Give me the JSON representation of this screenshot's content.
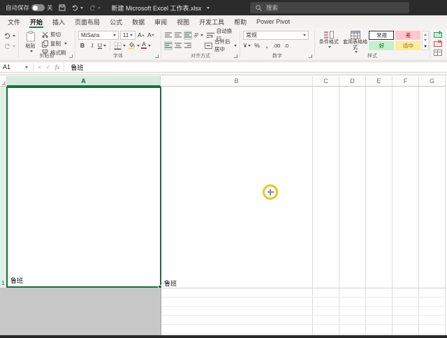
{
  "titlebar": {
    "autosave_label": "自动保存",
    "autosave_state": "关",
    "doc_title": "新建 Microsoft Excel 工作表.xlsx",
    "search_placeholder": "搜索"
  },
  "tabs": [
    "文件",
    "开始",
    "插入",
    "页面布局",
    "公式",
    "数据",
    "审阅",
    "视图",
    "开发工具",
    "帮助",
    "Power Pivot"
  ],
  "ribbon": {
    "clipboard": {
      "group_label": "剪贴板",
      "paste_label": "粘贴",
      "cut_label": "剪切",
      "copy_label": "复制",
      "format_painter_label": "格式刷"
    },
    "font": {
      "group_label": "字体",
      "font_name": "MiSans",
      "font_size": "11",
      "bold_glyph": "B",
      "italic_glyph": "I",
      "underline_glyph": "U",
      "grow_font_glyph": "A",
      "shrink_font_glyph": "A"
    },
    "alignment": {
      "group_label": "对齐方式",
      "wrap_text_label": "自动换行",
      "merge_center_label": "合并后居中"
    },
    "number": {
      "group_label": "数字",
      "format_value": "常规",
      "currency_glyph": "¥",
      "percent_glyph": "%",
      "comma_glyph": ",",
      "increase_decimal_glyph": ".00",
      "decrease_decimal_glyph": ".0"
    },
    "styles": {
      "group_label": "样式",
      "conditional_label": "条件格式",
      "format_table_label": "套用表格格式",
      "gallery": [
        {
          "label": "常规",
          "bg": "#ffffff",
          "fg": "#222222"
        },
        {
          "label": "差",
          "bg": "#ffc7ce",
          "fg": "#9c0006"
        },
        {
          "label": "好",
          "bg": "#c6efce",
          "fg": "#006100"
        },
        {
          "label": "适中",
          "bg": "#ffeb9c",
          "fg": "#9c6500"
        }
      ]
    }
  },
  "formula_bar": {
    "name_box": "A1",
    "fx_label": "fx",
    "cancel_glyph": "×",
    "enter_glyph": "✓",
    "content": "鲁班"
  },
  "sheet": {
    "column_headers": [
      "A",
      "B",
      "C",
      "D",
      "E",
      "F",
      "G"
    ],
    "selected_cell": "A1",
    "row_labels": [
      "1"
    ],
    "cells": {
      "A1": "鲁班",
      "B1": "鲁班"
    }
  },
  "colors": {
    "excel_green": "#217346",
    "selection_border": "#1a6b40",
    "titlebar_bg": "#2b2b2b",
    "click_ring": "#edc32a",
    "bad_bg": "#ffc7ce",
    "good_bg": "#c6efce",
    "neutral_bg": "#ffeb9c"
  }
}
